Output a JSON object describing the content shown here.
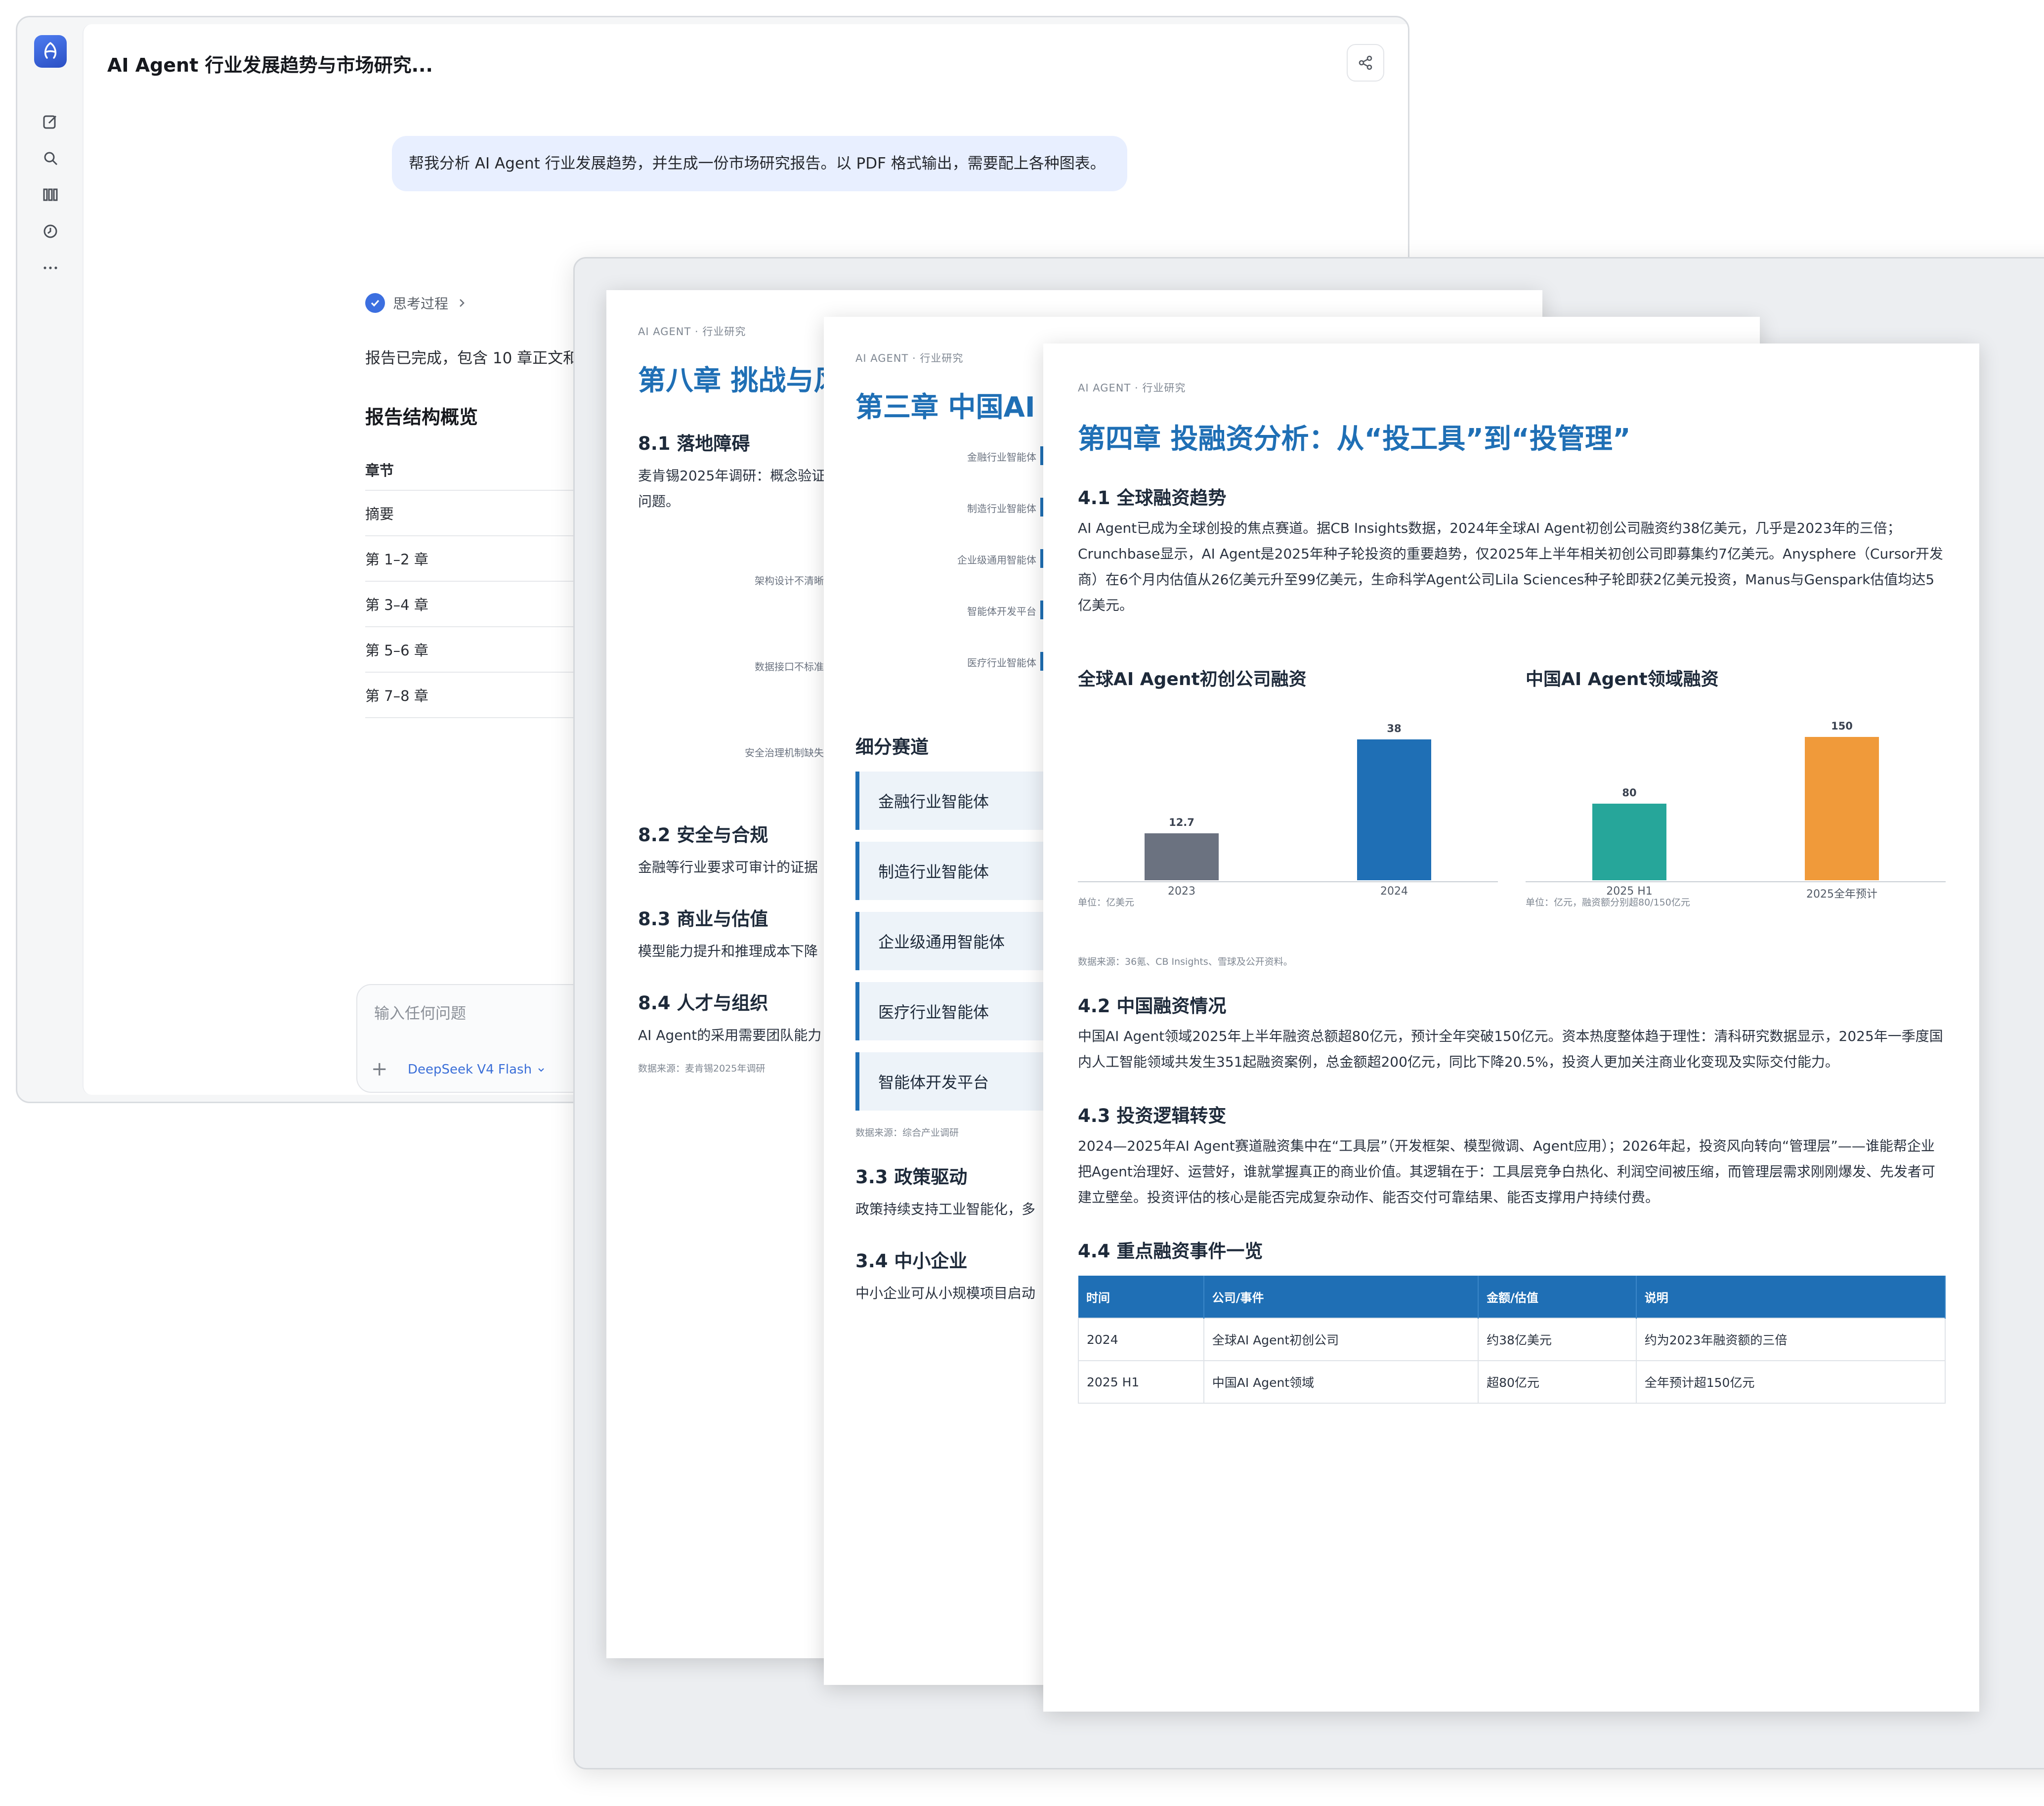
{
  "chat": {
    "title": "AI Agent 行业发展趋势与市场研究...",
    "user_message": "帮我分析 AI Agent 行业发展趋势，并生成一份市场研究报告。以 PDF 格式输出，需要配上各种图表。",
    "thinking_label": "思考过程",
    "answer_line": "报告已完成，包含 10 章正文和附",
    "overview_title": "报告结构概览",
    "overview_header": "章节",
    "overview_rows": [
      "摘要",
      "第 1–2 章",
      "第 3–4 章",
      "第 5–6 章",
      "第 7–8 章"
    ],
    "input_placeholder": "输入任何问题",
    "model_label": "DeepSeek V4 Flash"
  },
  "icons": {
    "logo": "app-logo-icon",
    "new_chat": "edit-icon",
    "search": "search-icon",
    "library": "library-icon",
    "history": "clock-icon",
    "more": "more-icon",
    "share": "share-icon"
  },
  "colors": {
    "accent": "#1f6fb5",
    "gray_bar": "#6b7280",
    "teal_bar": "#26a69a",
    "orange_bar": "#f09a3a"
  },
  "page8": {
    "kicker": "AI AGENT · 行业研究",
    "title": "第八章 挑战与风",
    "s1_title": "8.1 落地障碍",
    "s1_text_a": "麦肯锡2025年调研：概念验证",
    "s1_text_b": "问题。",
    "barriers": [
      "架构设计不清晰",
      "数据接口不标准",
      "安全治理机制缺失"
    ],
    "s2_title": "8.2 安全与合规",
    "s2_text": "金融等行业要求可审计的证据",
    "s3_title": "8.3 商业与估值",
    "s3_text": "模型能力提升和推理成本下降",
    "s4_title": "8.4 人才与组织",
    "s4_text": "AI Agent的采用需要团队能力",
    "source": "数据来源：麦肯锡2025年调研"
  },
  "page3": {
    "kicker": "AI AGENT · 行业研究",
    "title": "第三章 中国AI A",
    "bar_labels": [
      "金融行业智能体",
      "制造行业智能体",
      "企业级通用智能体",
      "智能体开发平台",
      "医疗行业智能体"
    ],
    "segments_title": "细分赛道",
    "segments": [
      "金融行业智能体",
      "制造行业智能体",
      "企业级通用智能体",
      "医疗行业智能体",
      "智能体开发平台"
    ],
    "source": "数据来源：综合产业调研",
    "s3_title": "3.3 政策驱动",
    "s3_text": "政策持续支持工业智能化，多",
    "s4_title": "3.4 中小企业",
    "s4_text": "中小企业可从小规模项目启动"
  },
  "page4": {
    "kicker": "AI AGENT · 行业研究",
    "title": "第四章 投融资分析：从“投工具”到“投管理”",
    "s1_title": "4.1 全球融资趋势",
    "s1_text": "AI Agent已成为全球创投的焦点赛道。据CB Insights数据，2024年全球AI Agent初创公司融资约38亿美元，几乎是2023年的三倍；Crunchbase显示，AI Agent是2025年种子轮投资的重要趋势，仅2025年上半年相关初创公司即募集约7亿美元。Anysphere（Cursor开发商）在6个月内估值从26亿美元升至99亿美元，生命科学Agent公司Lila Sciences种子轮即获2亿美元投资，Manus与Genspark估值均达5亿美元。",
    "charts_source": "数据来源：36氪、CB Insights、雪球及公开资料。",
    "s2_title": "4.2 中国融资情况",
    "s2_text": "中国AI Agent领域2025年上半年融资总额超80亿元，预计全年突破150亿元。资本热度整体趋于理性：清科研究数据显示，2025年一季度国内人工智能领域共发生351起融资案例，总金额超200亿元，同比下降20.5%，投资人更加关注商业化变现及实际交付能力。",
    "s3_title": "4.3 投资逻辑转变",
    "s3_text": "2024—2025年AI Agent赛道融资集中在“工具层”（开发框架、模型微调、Agent应用）；2026年起，投资风向转向“管理层”——谁能帮企业把Agent治理好、运营好，谁就掌握真正的商业价值。其逻辑在于：工具层竞争白热化、利润空间被压缩，而管理层需求刚刚爆发、先发者可建立壁垒。投资评估的核心是能否完成复杂动作、能否交付可靠结果、能否支撑用户持续付费。",
    "s4_title": "4.4 重点融资事件一览",
    "table_headers": [
      "时间",
      "公司/事件",
      "金额/估值",
      "说明"
    ],
    "table_rows": [
      [
        "2024",
        "全球AI Agent初创公司",
        "约38亿美元",
        "约为2023年融资额的三倍"
      ],
      [
        "2025 H1",
        "中国AI Agent领域",
        "超80亿元",
        "全年预计超150亿元"
      ]
    ]
  },
  "chart_data": [
    {
      "type": "bar",
      "title": "全球AI Agent初创公司融资",
      "categories": [
        "2023",
        "2024"
      ],
      "values": [
        12.7,
        38
      ],
      "data_labels": [
        "12.7",
        "38"
      ],
      "colors": [
        "#6b7280",
        "#1f6fb5"
      ],
      "unit_note": "单位：亿美元",
      "ylim": [
        0,
        40
      ]
    },
    {
      "type": "bar",
      "title": "中国AI Agent领域融资",
      "categories": [
        "2025 H1",
        "2025全年预计"
      ],
      "values": [
        80,
        150
      ],
      "data_labels": [
        "80",
        "150"
      ],
      "colors": [
        "#26a69a",
        "#f09a3a"
      ],
      "unit_note": "单位：亿元，融资额分别超80/150亿元",
      "ylim": [
        0,
        155
      ]
    }
  ]
}
